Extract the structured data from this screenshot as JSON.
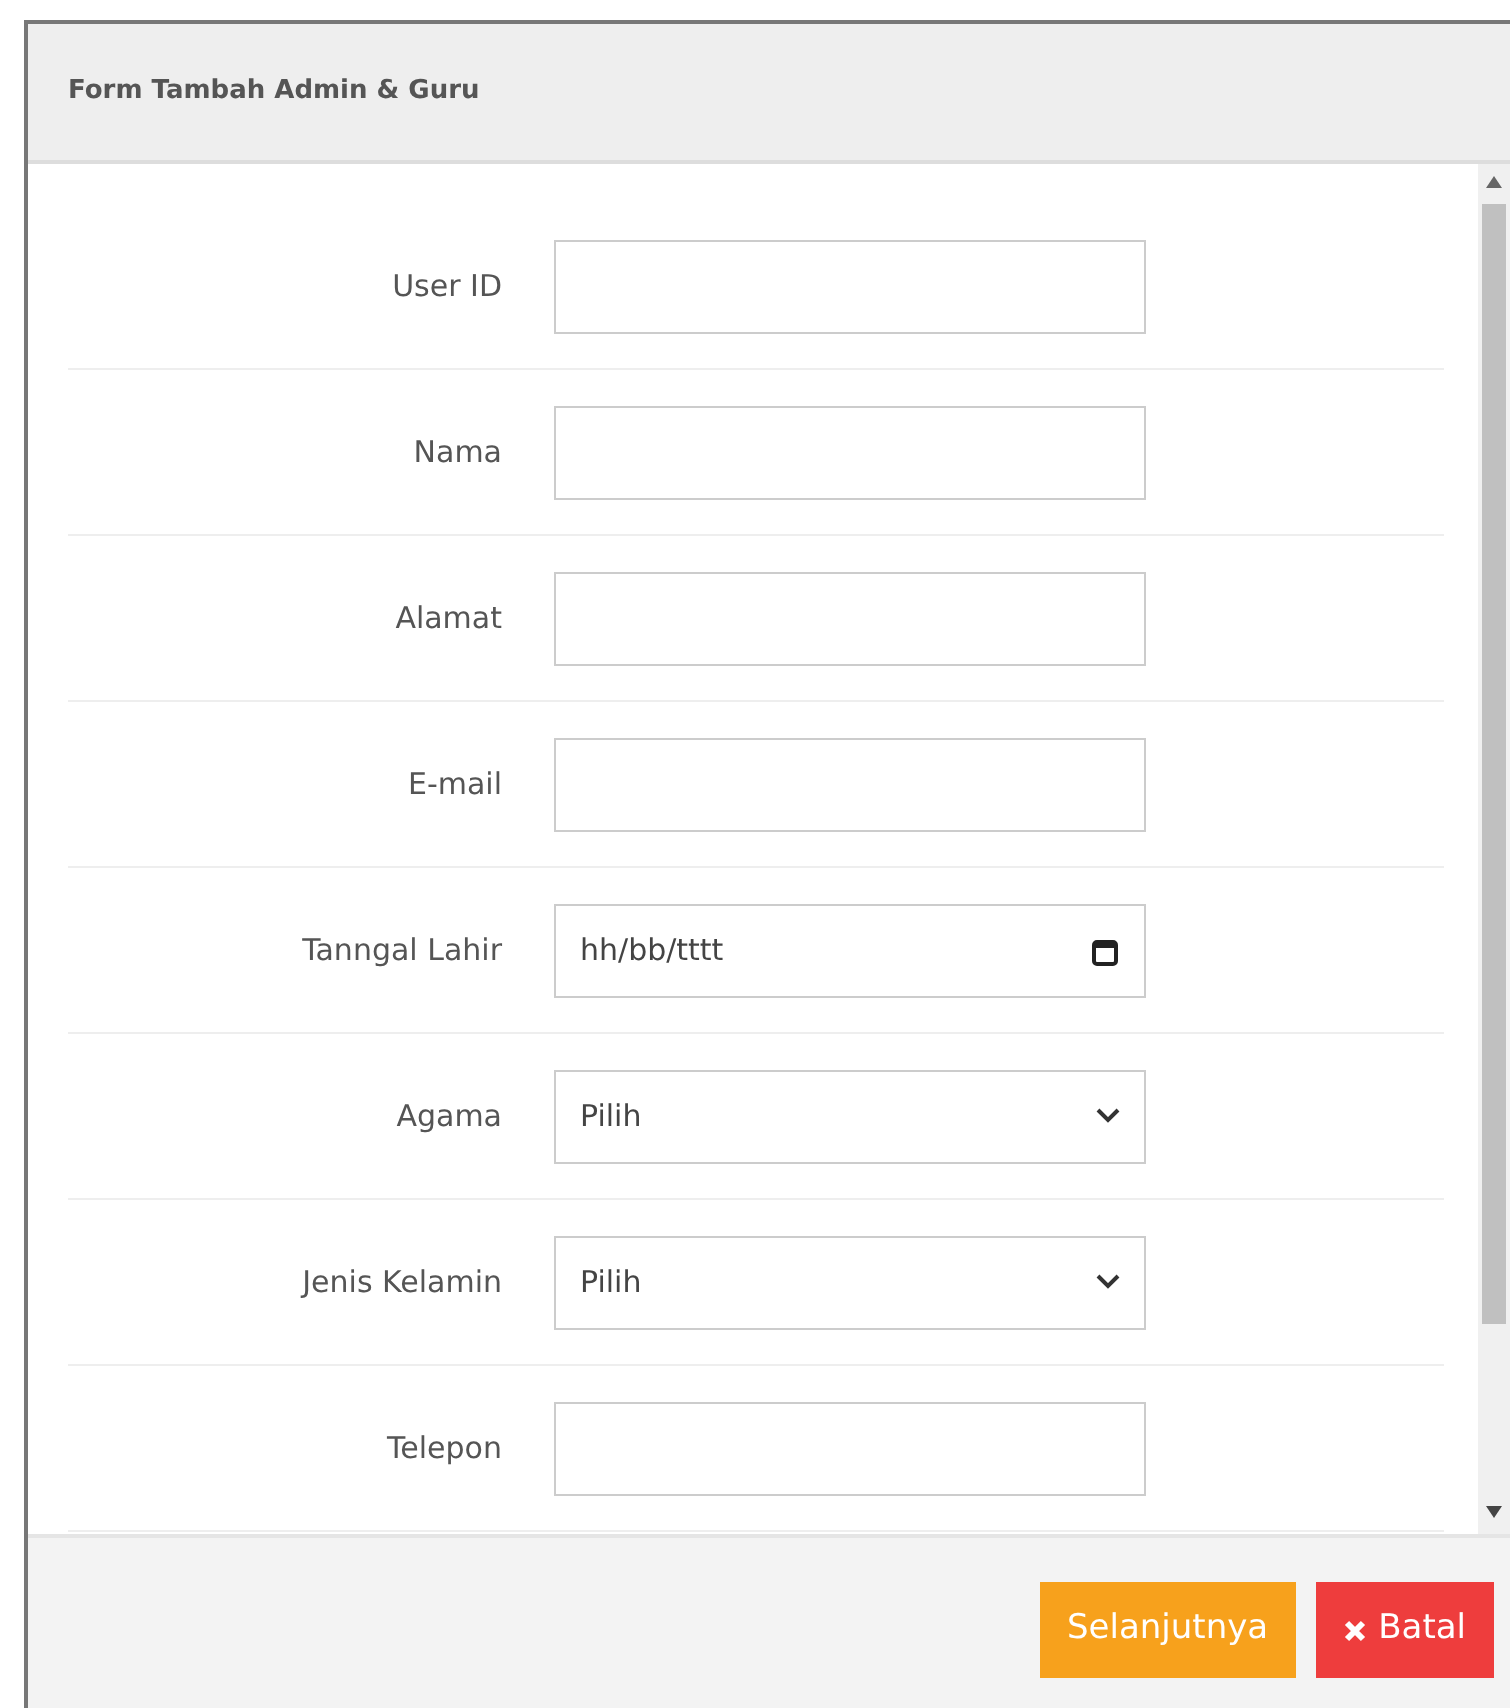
{
  "modal": {
    "title": "Form Tambah Admin & Guru"
  },
  "fields": [
    {
      "label": "User ID",
      "kind": "text"
    },
    {
      "label": "Nama",
      "kind": "text"
    },
    {
      "label": "Alamat",
      "kind": "text"
    },
    {
      "label": "E-mail",
      "kind": "text"
    },
    {
      "label": "Tanngal Lahir",
      "kind": "date",
      "placeholder": "hh/bb/tttt"
    },
    {
      "label": "Agama",
      "kind": "select",
      "value": "Pilih"
    },
    {
      "label": "Jenis Kelamin",
      "kind": "select",
      "value": "Pilih"
    },
    {
      "label": "Telepon",
      "kind": "text"
    }
  ],
  "buttons": [
    {
      "label": "Selanjutnya",
      "kind": "next"
    },
    {
      "label": "Batal",
      "kind": "cancel"
    }
  ]
}
